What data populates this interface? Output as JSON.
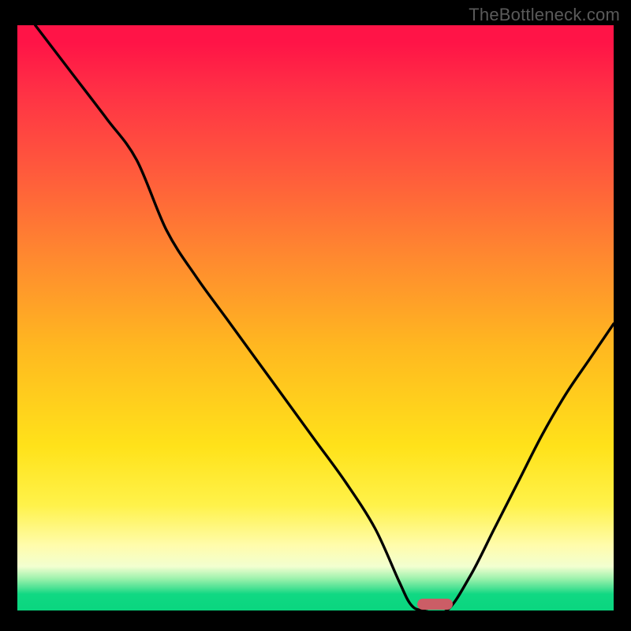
{
  "watermark": "TheBottleneck.com",
  "colors": {
    "background": "#000000",
    "curve": "#000000",
    "pill": "#cb5d66",
    "gradient_top": "#ff1447",
    "gradient_bottom": "#0ad67f"
  },
  "chart_data": {
    "type": "line",
    "title": "",
    "xlabel": "",
    "ylabel": "",
    "xlim": [
      0,
      100
    ],
    "ylim": [
      0,
      100
    ],
    "x": [
      3,
      9,
      15,
      20,
      25,
      30,
      35,
      40,
      45,
      50,
      55,
      60,
      64,
      66,
      68,
      72,
      76,
      80,
      84,
      88,
      92,
      96,
      100
    ],
    "values": [
      100,
      92,
      84,
      77,
      65,
      57,
      50,
      43,
      36,
      29,
      22,
      14,
      5,
      1,
      0,
      0,
      6,
      14,
      22,
      30,
      37,
      43,
      49
    ],
    "minimum_marker": {
      "x_center": 70,
      "y": 0,
      "width": 6
    },
    "annotations": [],
    "legend": []
  }
}
